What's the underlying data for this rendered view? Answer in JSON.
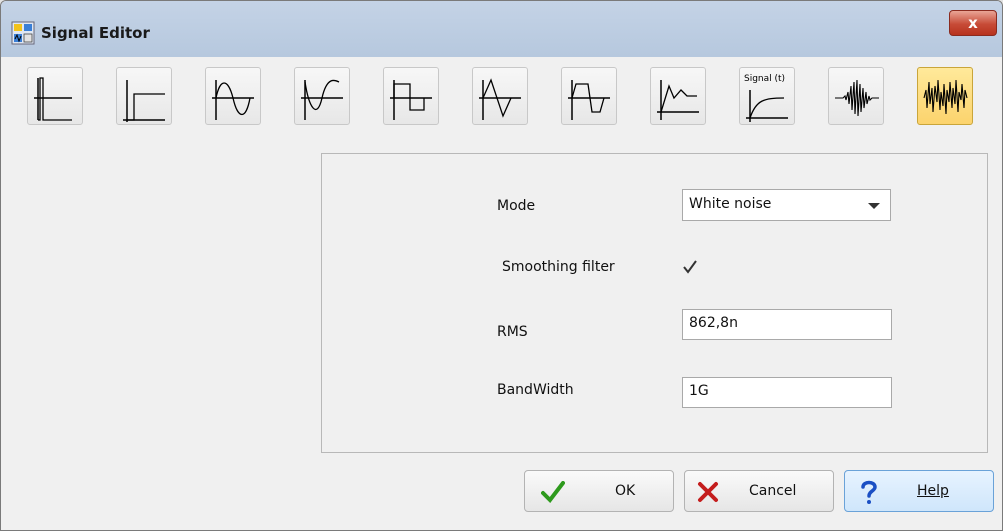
{
  "window": {
    "title": "Signal Editor",
    "close_glyph": "x"
  },
  "toolbar": {
    "tools": [
      {
        "icon": "impulse-icon"
      },
      {
        "icon": "step-icon"
      },
      {
        "icon": "sine-icon"
      },
      {
        "icon": "inverted-sine-icon"
      },
      {
        "icon": "square-wave-icon"
      },
      {
        "icon": "sawtooth-icon"
      },
      {
        "icon": "trapezoid-wave-icon"
      },
      {
        "icon": "piecewise-linear-icon"
      },
      {
        "icon": "time-function-icon",
        "label": "Signal (t)"
      },
      {
        "icon": "wave-packet-icon"
      },
      {
        "icon": "noise-icon",
        "selected": true
      }
    ]
  },
  "form": {
    "mode_label": "Mode",
    "mode_value": "White noise",
    "smoothing_label": "Smoothing filter",
    "smoothing_checked": true,
    "rms_label": "RMS",
    "rms_value": "862,8n",
    "bandwidth_label": "BandWidth",
    "bandwidth_value": "1G"
  },
  "buttons": {
    "ok_label": "OK",
    "cancel_label": "Cancel",
    "help_label": "Help"
  },
  "colors": {
    "ok_check": "#2e9a1d",
    "cancel_x": "#c41d1d",
    "help_q": "#1a4fc4",
    "active_tool": "#fcd36d"
  }
}
